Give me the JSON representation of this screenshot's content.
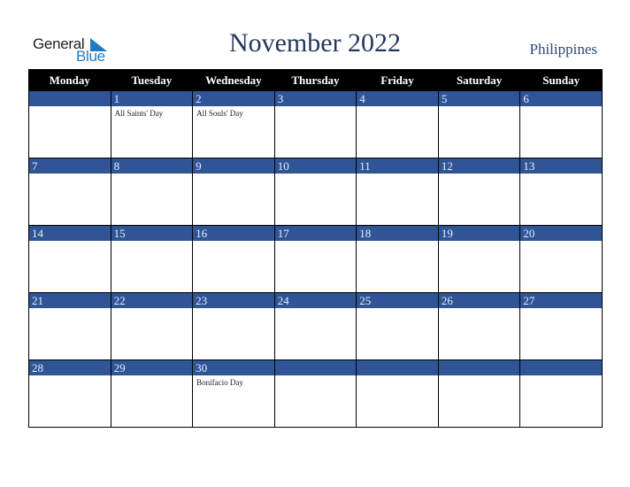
{
  "logo": {
    "line1": "General",
    "line2": "Blue"
  },
  "title": "November 2022",
  "country": "Philippines",
  "weekdays": [
    "Monday",
    "Tuesday",
    "Wednesday",
    "Thursday",
    "Friday",
    "Saturday",
    "Sunday"
  ],
  "weeks": [
    [
      {
        "day": ""
      },
      {
        "day": "1",
        "event": "All Saints' Day"
      },
      {
        "day": "2",
        "event": "All Souls' Day"
      },
      {
        "day": "3"
      },
      {
        "day": "4"
      },
      {
        "day": "5"
      },
      {
        "day": "6"
      }
    ],
    [
      {
        "day": "7"
      },
      {
        "day": "8"
      },
      {
        "day": "9"
      },
      {
        "day": "10"
      },
      {
        "day": "11"
      },
      {
        "day": "12"
      },
      {
        "day": "13"
      }
    ],
    [
      {
        "day": "14"
      },
      {
        "day": "15"
      },
      {
        "day": "16"
      },
      {
        "day": "17"
      },
      {
        "day": "18"
      },
      {
        "day": "19"
      },
      {
        "day": "20"
      }
    ],
    [
      {
        "day": "21"
      },
      {
        "day": "22"
      },
      {
        "day": "23"
      },
      {
        "day": "24"
      },
      {
        "day": "25"
      },
      {
        "day": "26"
      },
      {
        "day": "27"
      }
    ],
    [
      {
        "day": "28"
      },
      {
        "day": "29"
      },
      {
        "day": "30",
        "event": "Bonifacio Day"
      },
      {
        "day": ""
      },
      {
        "day": ""
      },
      {
        "day": ""
      },
      {
        "day": ""
      }
    ]
  ],
  "colors": {
    "header_bg": "#000000",
    "day_bar": "#2f5597",
    "title": "#22385e",
    "brand": "#1f7bc1"
  }
}
